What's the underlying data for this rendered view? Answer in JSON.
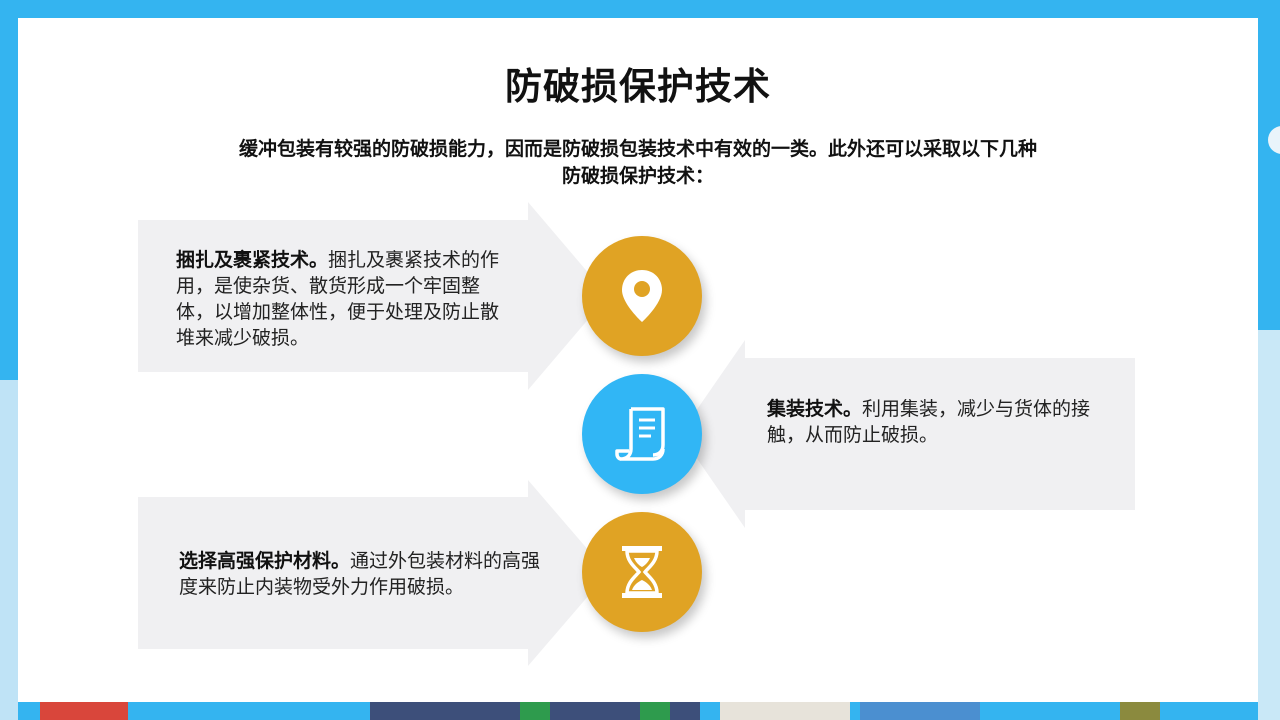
{
  "slide": {
    "title": "防破损保护技术",
    "intro": "缓冲包装有较强的防破损能力，因而是防破损包装技术中有效的一类。此外还可以采取以下几种防破损保护技术：",
    "items": [
      {
        "heading": "捆扎及裹紧技术。",
        "body": "捆扎及裹紧技术的作用，是使杂货、散货形成一个牢固整体，以增加整体性，便于处理及防止散堆来减少破损。",
        "icon": "location-pin-icon",
        "color": "#e0a324"
      },
      {
        "heading": "集装技术。",
        "body": "利用集装，减少与货体的接触，从而防止破损。",
        "icon": "document-scroll-icon",
        "color": "#31b6f5"
      },
      {
        "heading": "选择高强保护材料。",
        "body": "通过外包装材料的高强度来防止内装物受外力作用破损。",
        "icon": "hourglass-icon",
        "color": "#e0a324"
      }
    ]
  },
  "background": {
    "accent": "#34b4f0",
    "card": "#ffffff"
  }
}
